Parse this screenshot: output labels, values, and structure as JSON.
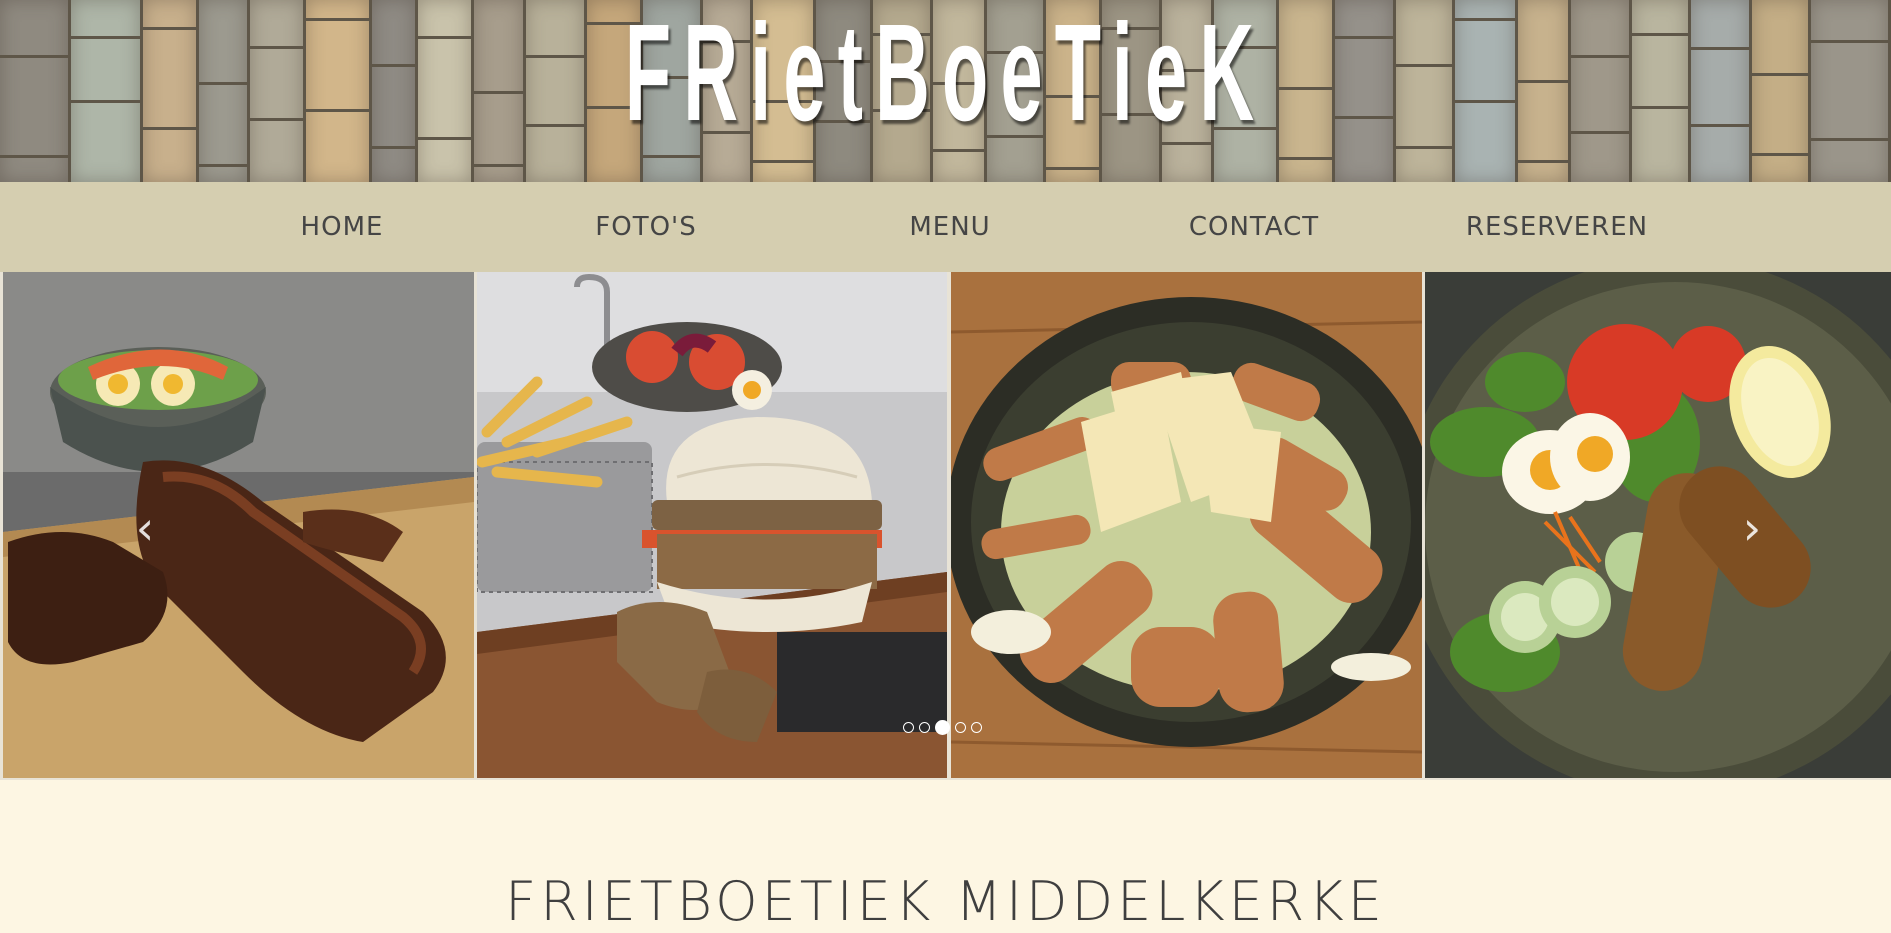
{
  "header": {
    "logo_text": "FRietBoeTieK"
  },
  "nav": {
    "items": [
      {
        "label": "HOME"
      },
      {
        "label": "FOTO'S"
      },
      {
        "label": "MENU"
      },
      {
        "label": "CONTACT"
      },
      {
        "label": "RESERVEREN"
      }
    ]
  },
  "slider": {
    "prev_icon": "chevron-left-icon",
    "next_icon": "chevron-right-icon",
    "prev_glyph": "‹",
    "next_glyph": "›",
    "dot_count": 5,
    "active_dot": 3,
    "photos": [
      {
        "subject": "ribs with salad on wooden board"
      },
      {
        "subject": "burger with fries in basket"
      },
      {
        "subject": "chicken caesar salad in dark bowl"
      },
      {
        "subject": "croquettes with salad and egg"
      }
    ]
  },
  "main": {
    "heading": "FRIETBOETIEK MIDDELKERKE"
  },
  "colors": {
    "background": "#fdf6e3",
    "nav_background": "#d5ceb0",
    "nav_text": "#454545",
    "heading_text": "#3f3f3f"
  }
}
